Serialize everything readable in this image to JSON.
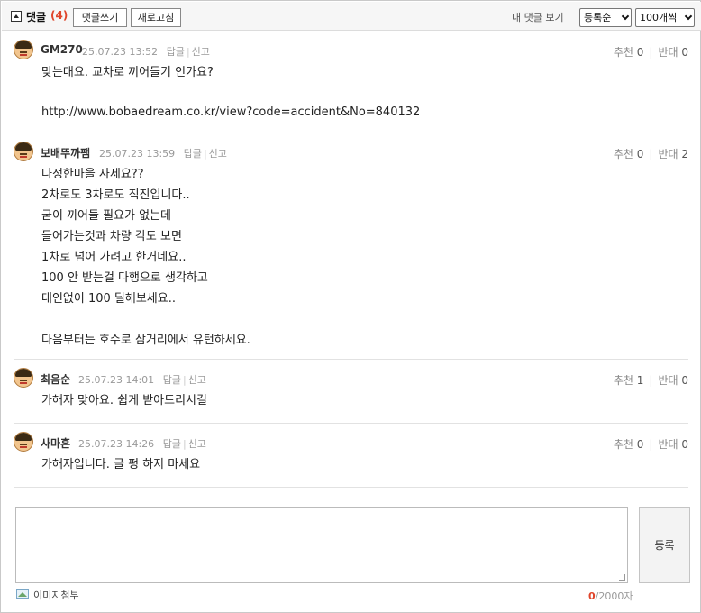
{
  "header": {
    "title": "댓글",
    "count": "(4)",
    "write_button": "댓글쓰기",
    "refresh_button": "새로고침",
    "my_comments": "내 댓글 보기",
    "sort_select": "등록순",
    "page_size_select": "100개씩"
  },
  "comments": [
    {
      "author": "GM270",
      "date": "25.07.23 13:52",
      "reply": "답글",
      "report": "신고",
      "up_label": "추천",
      "up": "0",
      "down_label": "반대",
      "down": "0",
      "lines": [
        "맞는대요. 교차로 끼어들기 인가요?",
        "",
        "http://www.bobaedream.co.kr/view?code=accident&No=840132"
      ]
    },
    {
      "author": "보배뚜까팸",
      "date": "25.07.23 13:59",
      "reply": "답글",
      "report": "신고",
      "up_label": "추천",
      "up": "0",
      "down_label": "반대",
      "down": "2",
      "lines": [
        "다정한마을 사세요??",
        "2차로도 3차로도 직진입니다..",
        "굳이 끼어들 필요가 없는데",
        "들어가는것과 차량 각도 보면",
        "1차로 넘어 가려고 한거네요..",
        "100 안 받는걸 다행으로 생각하고",
        "대인없이 100 딜해보세요..",
        "",
        "다음부터는 호수로 삼거리에서 유턴하세요."
      ]
    },
    {
      "author": "최음순",
      "date": "25.07.23 14:01",
      "reply": "답글",
      "report": "신고",
      "up_label": "추천",
      "up": "1",
      "down_label": "반대",
      "down": "0",
      "lines": [
        "가해자 맞아요. 쉽게 받아드리시길"
      ]
    },
    {
      "author": "사마혼",
      "date": "25.07.23 14:26",
      "reply": "답글",
      "report": "신고",
      "up_label": "추천",
      "up": "0",
      "down_label": "반대",
      "down": "0",
      "lines": [
        "가해자입니다. 글 펑 하지 마세요"
      ]
    }
  ],
  "write": {
    "submit_button": "등록",
    "image_attach": "이미지첨부",
    "char_current": "0",
    "char_max": "/2000자"
  }
}
